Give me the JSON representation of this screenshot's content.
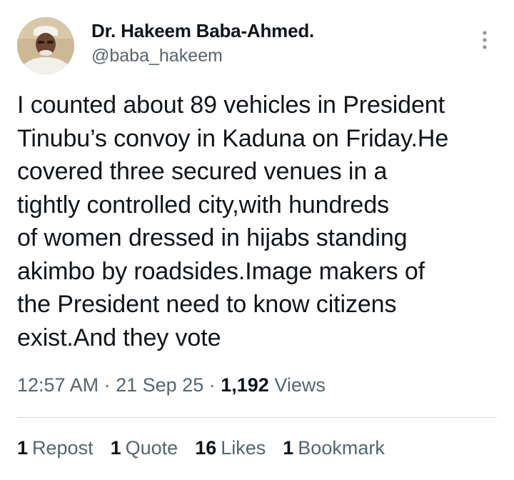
{
  "author": {
    "display_name": "Dr. Hakeem Baba-Ahmed.",
    "handle": "@baba_hakeem",
    "avatar_icon": "profile-photo"
  },
  "more_icon": "more-vertical-icon",
  "tweet": {
    "lines": [
      "I counted about 89 vehicles in President",
      "Tinubu’s convoy in Kaduna on Friday.He",
      "covered three secured venues in a",
      "tightly controlled city,with hundreds",
      "of women dressed in hijabs standing",
      "akimbo by roadsides.Image makers of",
      "the President need to know citizens",
      "exist.And they vote"
    ]
  },
  "meta": {
    "time": "12:57 AM",
    "separator": "·",
    "date": "21 Sep 25",
    "views_count": "1,192",
    "views_label": "Views"
  },
  "stats": {
    "reposts": {
      "count": "1",
      "label": "Repost"
    },
    "quotes": {
      "count": "1",
      "label": "Quote"
    },
    "likes": {
      "count": "16",
      "label": "Likes"
    },
    "bookmarks": {
      "count": "1",
      "label": "Bookmark"
    }
  },
  "colors": {
    "text": "#0f1419",
    "secondary": "#536471",
    "divider": "#cfd9de"
  }
}
